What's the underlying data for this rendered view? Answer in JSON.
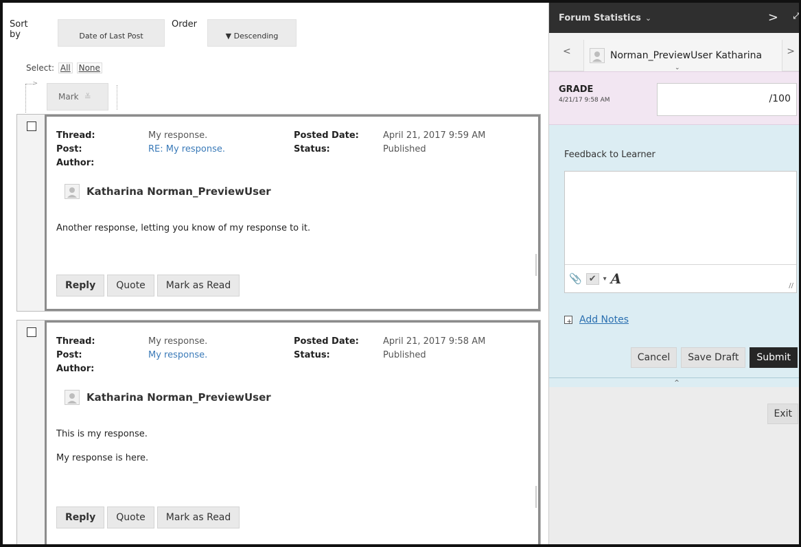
{
  "toolbar": {
    "sort_by_label": "Sort by",
    "sort_value": "Date of Last Post",
    "order_label": "Order",
    "order_value": "▼ Descending",
    "select_label": "Select:",
    "select_all": "All",
    "select_none": "None",
    "mark_label": "Mark"
  },
  "posts": [
    {
      "thread_key": "Thread:",
      "thread": "My response.",
      "post_key": "Post:",
      "post": "RE: My response.",
      "author_key": "Author:",
      "author": "Katharina Norman_PreviewUser",
      "posted_date_key": "Posted Date:",
      "posted_date": "April 21, 2017 9:59 AM",
      "status_key": "Status:",
      "status": "Published",
      "body": [
        "Another response, letting you know of my response to it."
      ],
      "actions": [
        "Reply",
        "Quote",
        "Mark as Read"
      ]
    },
    {
      "thread_key": "Thread:",
      "thread": "My response.",
      "post_key": "Post:",
      "post": "My response.",
      "author_key": "Author:",
      "author": "Katharina Norman_PreviewUser",
      "posted_date_key": "Posted Date:",
      "posted_date": "April 21, 2017 9:58 AM",
      "status_key": "Status:",
      "status": "Published",
      "body": [
        "This is my response.",
        "My response is here."
      ],
      "actions": [
        "Reply",
        "Quote",
        "Mark as Read"
      ]
    }
  ],
  "panel": {
    "title": "Forum Statistics",
    "user_name": "Norman_PreviewUser Katharina",
    "grade_label": "GRADE",
    "grade_date": "4/21/17 9:58 AM",
    "grade_out_of": "/100",
    "feedback_label": "Feedback to Learner",
    "add_notes": "Add Notes",
    "cancel": "Cancel",
    "save_draft": "Save Draft",
    "submit": "Submit",
    "exit": "Exit"
  },
  "icons": {
    "dropdown": "chevron-down-icon",
    "next": "chevron-right-icon",
    "prev": "chevron-left-icon",
    "expand": "expand-icon",
    "attach": "paperclip-icon",
    "spell": "spellcheck-icon",
    "text_format": "text-format-icon",
    "notes": "add-note-icon",
    "avatar": "user-avatar-icon"
  }
}
